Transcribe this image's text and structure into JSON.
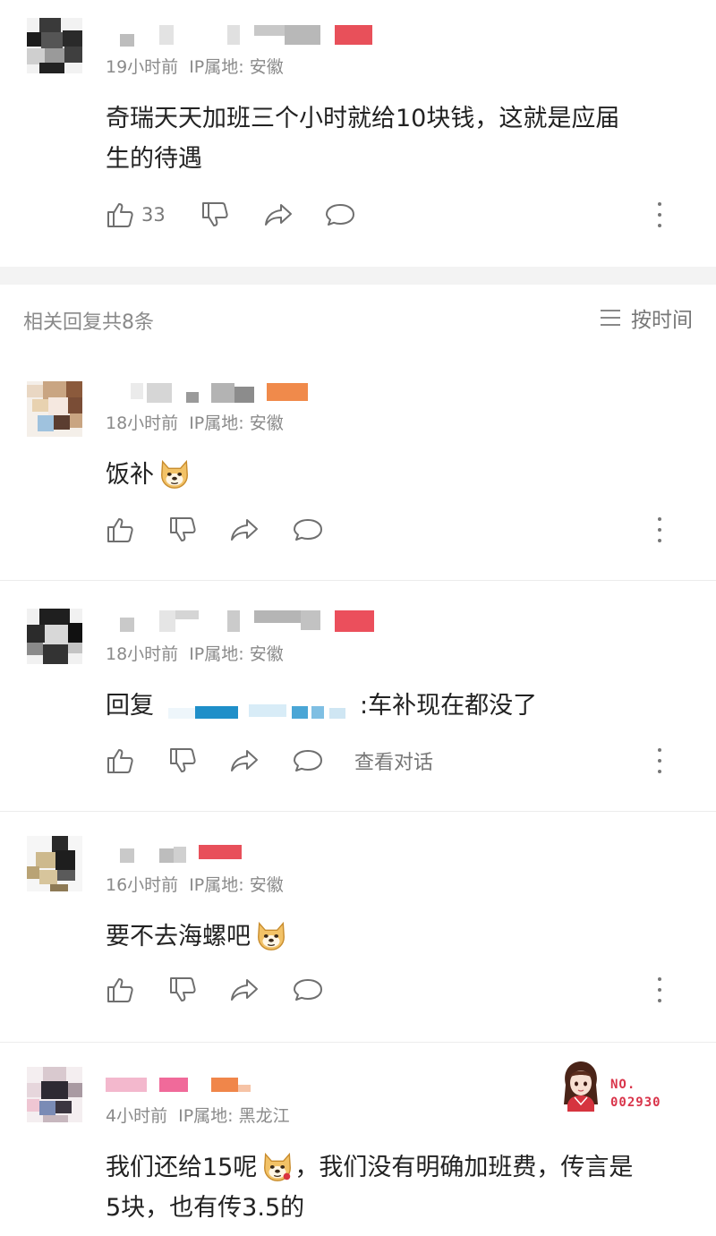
{
  "comment": {
    "time": "19小时前",
    "ip": "IP属地: 安徽",
    "text_line1": "奇瑞天天加班三个小时就给10块钱，这就是应届",
    "text_line2": "生的待遇",
    "like_count": "33"
  },
  "replies_header": {
    "count_text": "相关回复共8条",
    "sort_label": "按时间"
  },
  "replies": [
    {
      "time": "18小时前",
      "ip": "IP属地: 安徽",
      "text": "饭补",
      "emoji": "doge-emoji"
    },
    {
      "time": "18小时前",
      "ip": "IP属地: 安徽",
      "reply_prefix": "回复",
      "text": ":车补现在都没了",
      "view_conversation": "查看对话"
    },
    {
      "time": "16小时前",
      "ip": "IP属地: 安徽",
      "text": "要不去海螺吧",
      "emoji": "doge-emoji"
    },
    {
      "time": "4小时前",
      "ip": "IP属地: 黑龙江",
      "text_part1": "我们还给15呢",
      "text_part2": "，我们没有明确加班费，传言是",
      "text_line2": "5块，也有传3.5的",
      "badge_no": "NO.",
      "badge_num": "002930"
    }
  ],
  "colors": {
    "text": "#222222",
    "meta": "#8a8a8a",
    "icon": "#6f6f6f",
    "divider": "#ececec",
    "section_gap": "#f3f3f3"
  }
}
